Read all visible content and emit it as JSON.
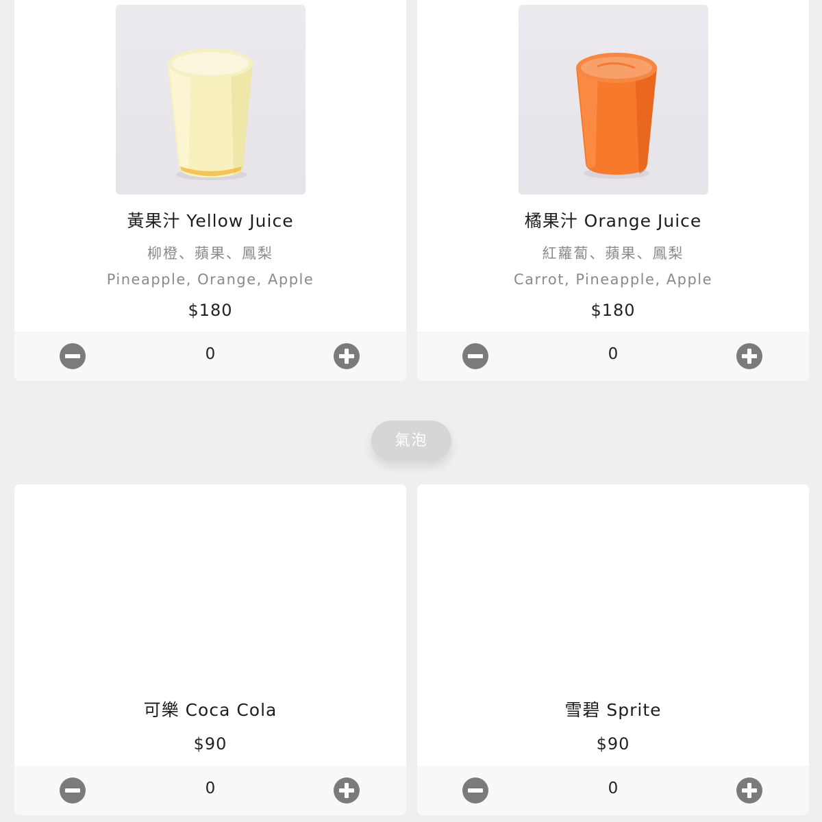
{
  "category": {
    "label": "氣泡"
  },
  "products": [
    {
      "name": "黃果汁 Yellow Juice",
      "desc_zh": "柳橙、蘋果、鳳梨",
      "desc_en": "Pineapple, Orange, Apple",
      "price": "$180",
      "quantity": "0",
      "image": "yellow-juice-glass",
      "juice_color": "#f8f1bd"
    },
    {
      "name": "橘果汁 Orange Juice",
      "desc_zh": "紅蘿蔔、蘋果、鳳梨",
      "desc_en": "Carrot, Pineapple, Apple",
      "price": "$180",
      "quantity": "0",
      "image": "orange-juice-glass",
      "juice_color": "#f77a2c"
    },
    {
      "name": "可樂 Coca Cola",
      "price": "$90",
      "quantity": "0"
    },
    {
      "name": "雪碧 Sprite",
      "price": "$90",
      "quantity": "0"
    }
  ],
  "icons": {
    "decrease": "minus-circle-icon",
    "increase": "plus-circle-icon"
  },
  "colors": {
    "background": "#efefef",
    "card": "#ffffff",
    "quantity_bar": "#f8f8f8",
    "button": "#7b7b7b",
    "pill": "#d6d6d6"
  }
}
